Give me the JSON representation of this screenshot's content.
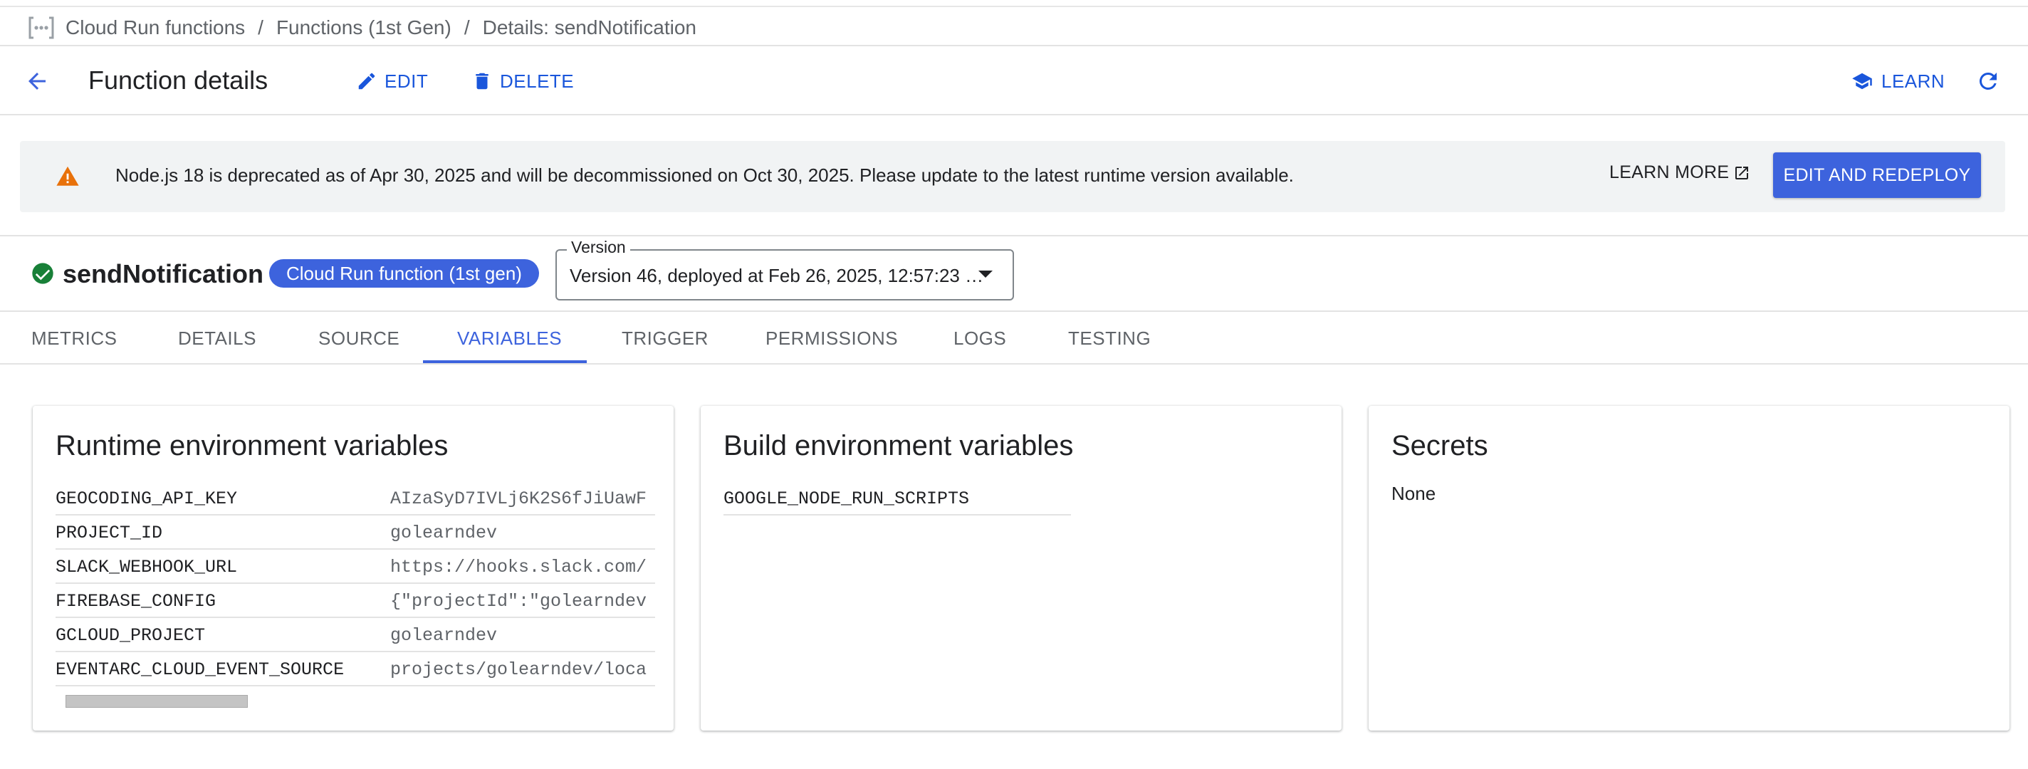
{
  "breadcrumb": {
    "items": [
      "Cloud Run functions",
      "Functions (1st Gen)",
      "Details: sendNotification"
    ],
    "separator": "/"
  },
  "header": {
    "title": "Function details",
    "edit_label": "EDIT",
    "delete_label": "DELETE",
    "learn_label": "LEARN"
  },
  "banner": {
    "message": "Node.js 18 is deprecated as of Apr 30, 2025 and will be decommissioned on Oct 30, 2025. Please update to the latest runtime version available.",
    "learn_more_label": "LEARN MORE",
    "action_label": "EDIT AND REDEPLOY",
    "warning_color": "#e8710a"
  },
  "function": {
    "name": "sendNotification",
    "status": "active",
    "status_color": "#188038",
    "chip_label": "Cloud Run function (1st gen)",
    "version_label": "Version",
    "version_value": "Version 46, deployed at Feb 26, 2025, 12:57:23 …"
  },
  "tabs": [
    {
      "label": "METRICS",
      "active": false
    },
    {
      "label": "DETAILS",
      "active": false
    },
    {
      "label": "SOURCE",
      "active": false
    },
    {
      "label": "VARIABLES",
      "active": true
    },
    {
      "label": "TRIGGER",
      "active": false
    },
    {
      "label": "PERMISSIONS",
      "active": false
    },
    {
      "label": "LOGS",
      "active": false
    },
    {
      "label": "TESTING",
      "active": false
    }
  ],
  "runtime_env": {
    "title": "Runtime environment variables",
    "rows": [
      {
        "key": "GEOCODING_API_KEY",
        "value": "AIzaSyD7IVLj6K2S6fJiUawF"
      },
      {
        "key": "PROJECT_ID",
        "value": "golearndev"
      },
      {
        "key": "SLACK_WEBHOOK_URL",
        "value": "https://hooks.slack.com/"
      },
      {
        "key": "FIREBASE_CONFIG",
        "value": "{\"projectId\":\"golearndev"
      },
      {
        "key": "GCLOUD_PROJECT",
        "value": "golearndev"
      },
      {
        "key": "EVENTARC_CLOUD_EVENT_SOURCE",
        "value": "projects/golearndev/loca"
      }
    ]
  },
  "build_env": {
    "title": "Build environment variables",
    "rows": [
      {
        "key": "GOOGLE_NODE_RUN_SCRIPTS"
      }
    ]
  },
  "secrets": {
    "title": "Secrets",
    "empty_text": "None"
  },
  "colors": {
    "accent": "#3d63dd",
    "link": "#1a56db"
  }
}
